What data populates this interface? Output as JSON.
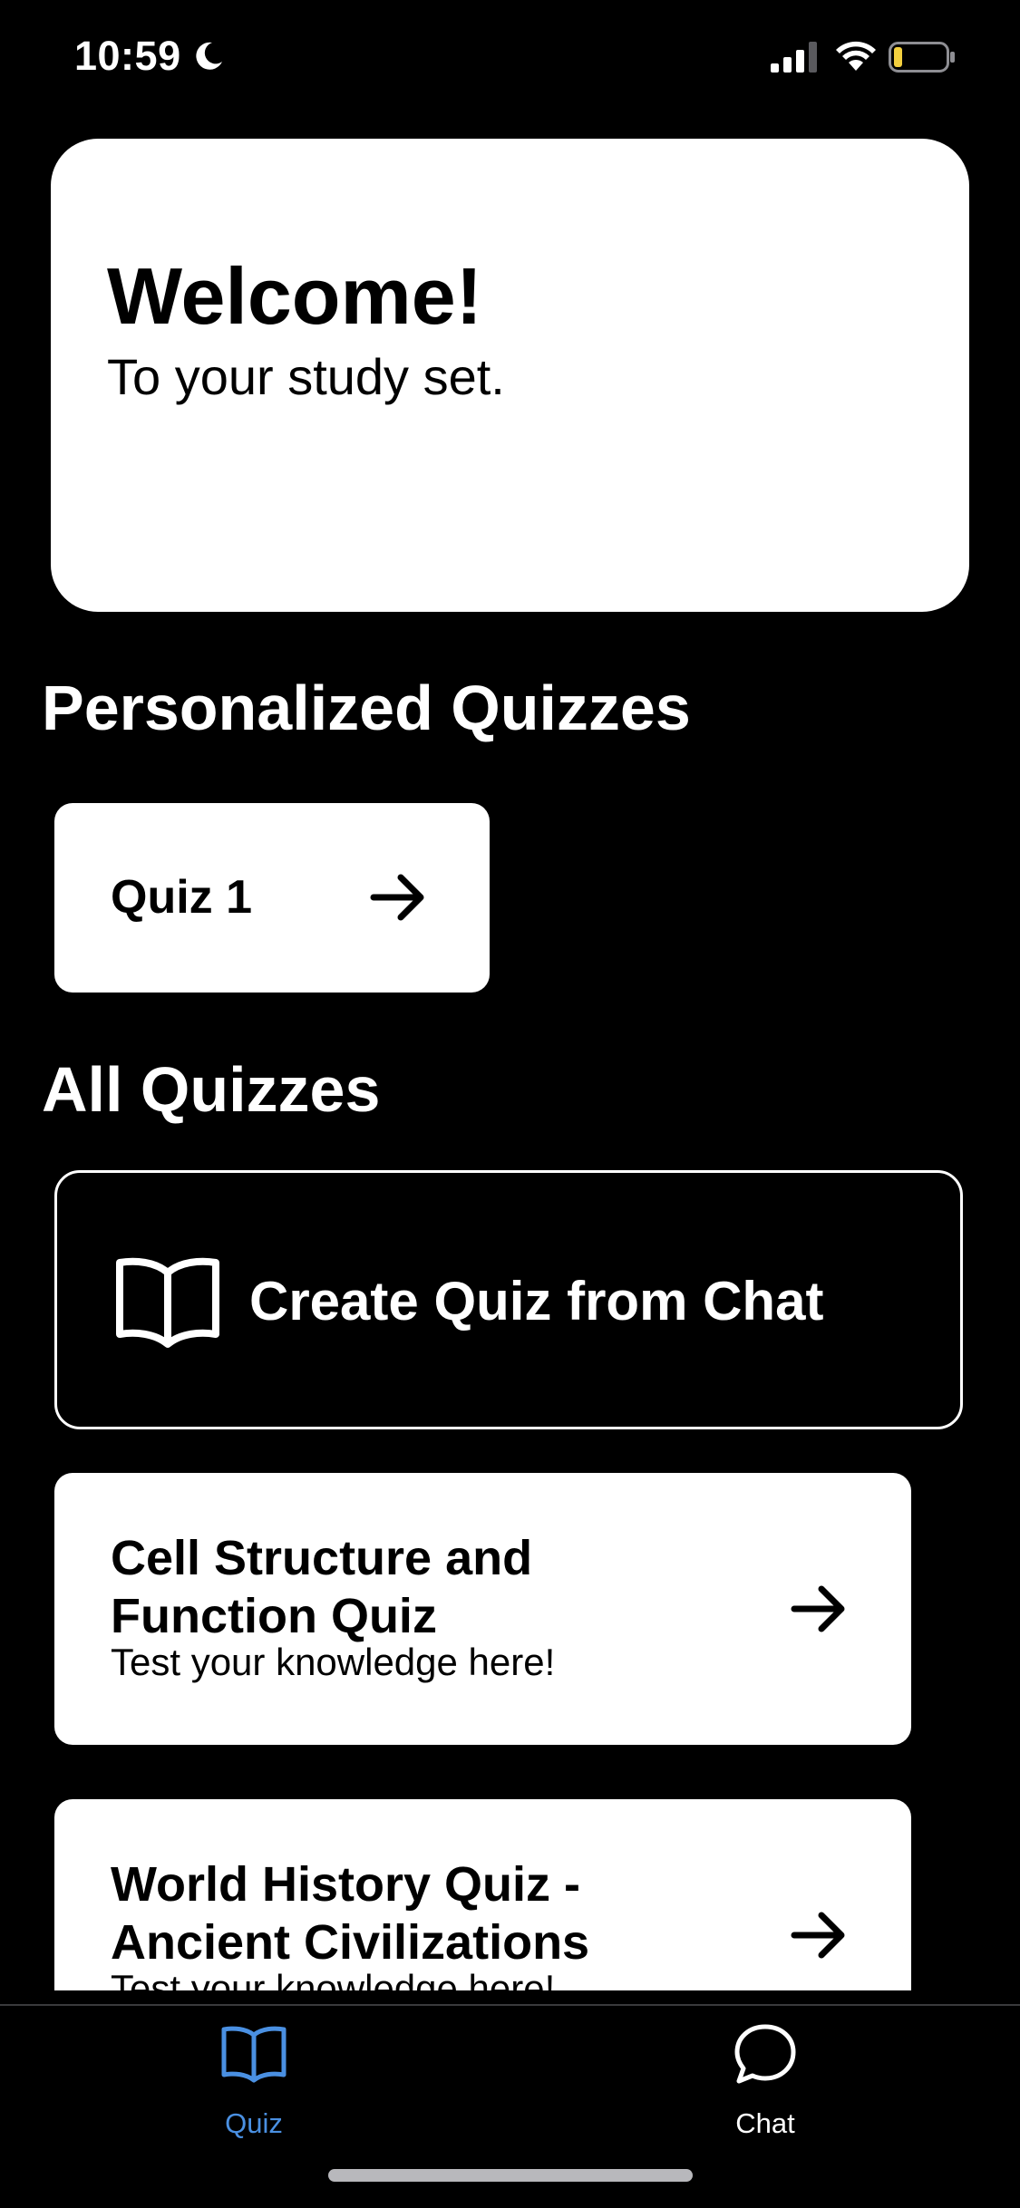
{
  "status_bar": {
    "time": "10:59",
    "icons": [
      "moon-icon",
      "signal-icon",
      "wifi-icon",
      "battery-icon"
    ],
    "battery_color": "#f4d03f"
  },
  "welcome": {
    "title": "Welcome!",
    "subtitle": "To your study set."
  },
  "personalized": {
    "heading": "Personalized Quizzes",
    "items": [
      {
        "label": "Quiz 1"
      }
    ]
  },
  "all_quizzes": {
    "heading": "All Quizzes",
    "create_label": "Create Quiz from Chat",
    "items": [
      {
        "title": "Cell Structure and Function Quiz",
        "subtitle": "Test your knowledge here!"
      },
      {
        "title": "World History Quiz - Ancient Civilizations",
        "subtitle": "Test your knowledge here!"
      }
    ]
  },
  "tab_bar": {
    "tabs": [
      {
        "label": "Quiz",
        "icon": "book-icon",
        "active": true
      },
      {
        "label": "Chat",
        "icon": "chat-bubble-icon",
        "active": false
      }
    ],
    "active_color": "#4a90e2"
  }
}
